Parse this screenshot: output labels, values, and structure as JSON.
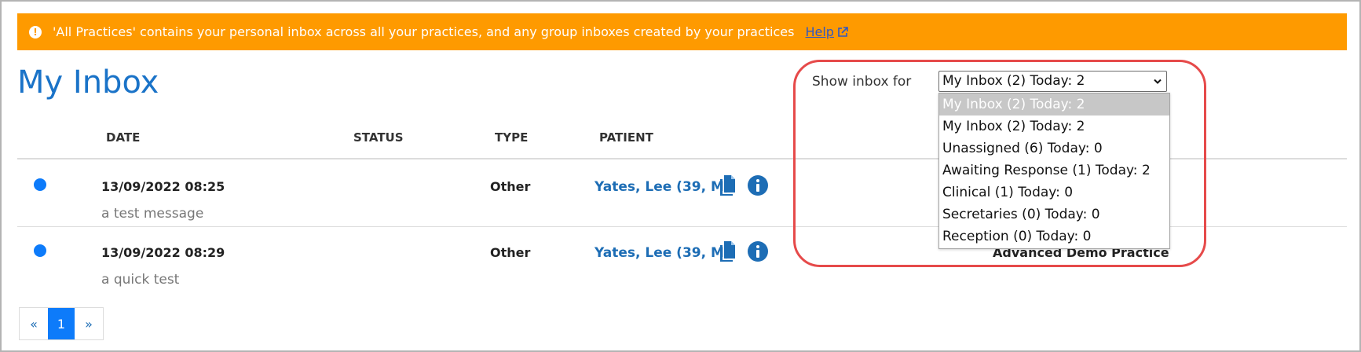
{
  "banner": {
    "message": "'All Practices' contains your personal inbox across all your practices, and any group inboxes created by your practices",
    "help_label": "Help"
  },
  "page": {
    "title": "My Inbox"
  },
  "columns": {
    "date": "DATE",
    "status": "STATUS",
    "type": "TYPE",
    "patient": "PATIENT"
  },
  "rows": [
    {
      "date": "13/09/2022 08:25",
      "subject": "a test message",
      "status": "",
      "type": "Other",
      "patient": "Yates, Lee (39, M)",
      "practice": ""
    },
    {
      "date": "13/09/2022 08:29",
      "subject": "a quick test",
      "status": "",
      "type": "Other",
      "patient": "Yates, Lee (39, M)",
      "practice": "Advanced Demo Practice"
    }
  ],
  "pagination": {
    "prev": "«",
    "current": "1",
    "next": "»"
  },
  "inbox_filter": {
    "label": "Show inbox for",
    "selected": "My Inbox (2) Today: 2",
    "options": [
      "My Inbox (2) Today: 2",
      "My Inbox (2) Today: 2",
      "Unassigned (6) Today: 0",
      "Awaiting Response (1) Today: 2",
      "Clinical (1) Today: 0",
      "Secretaries (0) Today: 0",
      "Reception (0) Today: 0"
    ]
  },
  "colors": {
    "banner": "#fe9a00",
    "title": "#1a73c8",
    "link": "#1d6db5",
    "unread_dot": "#0d7bfa",
    "highlight": "#e64a4a"
  },
  "icons": {
    "banner": "warning-circle-icon",
    "help": "external-link-icon",
    "row_document": "document-copy-icon",
    "row_info": "info-circle-icon",
    "select": "chevron-down-icon"
  }
}
